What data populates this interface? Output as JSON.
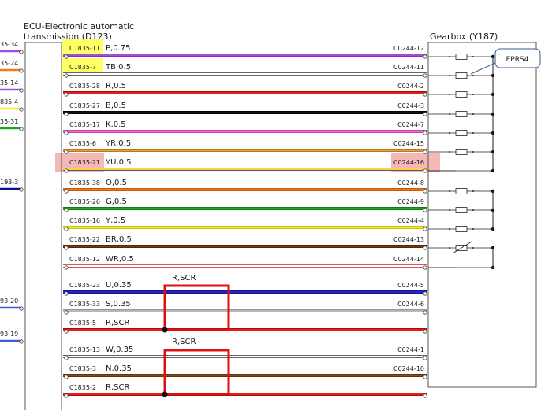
{
  "ecu": {
    "title_line1": "ECU-Electronic automatic",
    "title_line2": "transmission (D123)"
  },
  "gearbox": {
    "title": "Gearbox (Y187)"
  },
  "callout": {
    "label": "EPRS4"
  },
  "left_stubs": [
    "35-34",
    "35-24",
    "35-14",
    "835-4",
    "35-31",
    "193-3",
    "93-20",
    "93-19"
  ],
  "rows": [
    {
      "pin": "C1835-11",
      "wire": "P,0.75",
      "gb_pin": "C0244-12",
      "color": "#a64ad9",
      "stroke": "#7a2aa8",
      "highlight": "yellow",
      "resistor": "R",
      "bus": "A"
    },
    {
      "pin": "C1835-7",
      "wire": "TB,0.5",
      "gb_pin": "C0244-11",
      "color": "#ffffff",
      "stroke": "#333333",
      "highlight": "yellow",
      "resistor": "R",
      "bus": "A"
    },
    {
      "pin": "C1835-28",
      "wire": "R,0.5",
      "gb_pin": "C0244-2",
      "color": "#e0201c",
      "stroke": "#a00000",
      "resistor": "R",
      "bus": "A"
    },
    {
      "pin": "C1835-27",
      "wire": "B,0.5",
      "gb_pin": "C0244-3",
      "color": "#111111",
      "stroke": "#000000",
      "resistor": "R",
      "bus": "A"
    },
    {
      "pin": "C1835-17",
      "wire": "K,0.5",
      "gb_pin": "C0244-7",
      "color": "#f06ad8",
      "stroke": "#b23a9e",
      "resistor": "R",
      "bus": "A"
    },
    {
      "pin": "C1835-6",
      "wire": "YR,0.5",
      "gb_pin": "C0244-15",
      "color": "#e8a23a",
      "stroke": "#a66a1a",
      "resistor": "R",
      "bus": "A"
    },
    {
      "pin": "C1835-21",
      "wire": "YU,0.5",
      "gb_pin": "C0244-16",
      "color": "#ffd23a",
      "stroke": "#1a2a8a",
      "highlight": "pink",
      "bus": "A"
    },
    {
      "pin": "C1835-38",
      "wire": "O,0.5",
      "gb_pin": "C0244-8",
      "color": "#f07a14",
      "stroke": "#b0500a",
      "resistor": "R",
      "bus": "B"
    },
    {
      "pin": "C1835-26",
      "wire": "G,0.5",
      "gb_pin": "C0244-9",
      "color": "#1fa81f",
      "stroke": "#0e700e",
      "resistor": "R",
      "bus": "B"
    },
    {
      "pin": "C1835-16",
      "wire": "Y,0.5",
      "gb_pin": "C0244-4",
      "color": "#f7ee2a",
      "stroke": "#b8b000",
      "resistor": "R",
      "bus": "B"
    },
    {
      "pin": "C1835-22",
      "wire": "BR,0.5",
      "gb_pin": "C0244-13",
      "color": "#7a3a12",
      "stroke": "#4a2008",
      "resistor": "V",
      "bus": "C"
    },
    {
      "pin": "C1835-12",
      "wire": "WR,0.5",
      "gb_pin": "C0244-14",
      "color": "#ffffff",
      "stroke": "#d02020",
      "bus": "C"
    },
    {
      "pin": "C1835-23",
      "wire": "U,0.35",
      "gb_pin": "C0244-5",
      "color": "#2525c0",
      "stroke": "#10108a"
    },
    {
      "pin": "C1835-33",
      "wire": "S,0.35",
      "gb_pin": "C0244-6",
      "color": "#b8b8b8",
      "stroke": "#8a8a8a"
    },
    {
      "pin": "C1835-5",
      "wire": "R,SCR",
      "gb_pin": "",
      "color": "#e0201c",
      "stroke": "#a00000"
    },
    {
      "pin": "C1835-13",
      "wire": "W,0.35",
      "gb_pin": "C0244-1",
      "color": "#ffffff",
      "stroke": "#333333"
    },
    {
      "pin": "C1835-3",
      "wire": "N,0.35",
      "gb_pin": "C0244-10",
      "color": "#8a4a14",
      "stroke": "#5a2a08"
    },
    {
      "pin": "C1835-2",
      "wire": "R,SCR",
      "gb_pin": "",
      "color": "#e0201c",
      "stroke": "#a00000"
    }
  ],
  "shields": [
    {
      "label": "R,SCR"
    },
    {
      "label": "R,SCR"
    }
  ],
  "colors": {
    "highlight_yellow": "#ffff66",
    "highlight_pink": "#f5b8b8",
    "shield_box": "#e01010",
    "frame": "#555555"
  }
}
